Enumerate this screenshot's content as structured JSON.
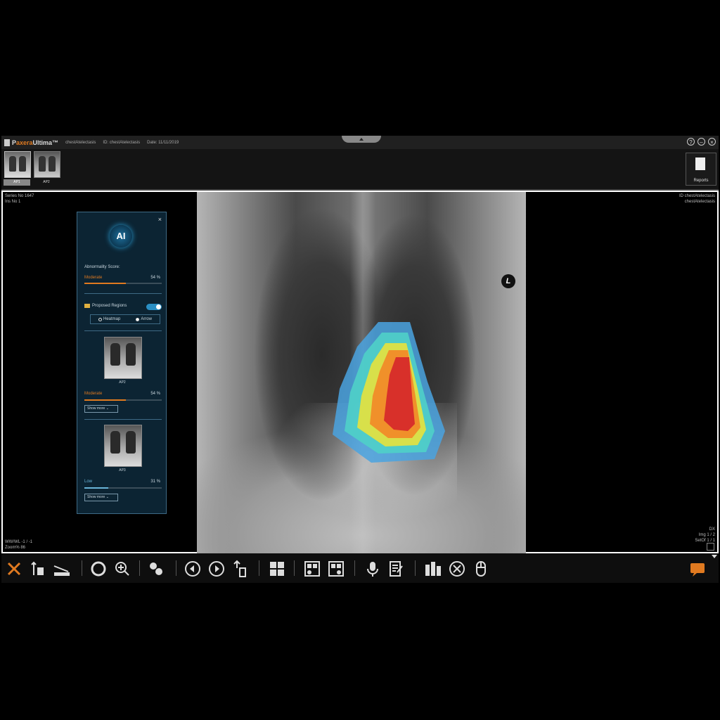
{
  "titlebar": {
    "app_name_prefix": "P",
    "app_name_accent": "axera",
    "app_name_suffix": "Ultima™",
    "patient": "chestAtelectasis",
    "id": "ID: chestAtelectasis",
    "date": "Date: 11/11/2019",
    "buttons": [
      "?",
      "–",
      "×"
    ]
  },
  "thumbnails": [
    {
      "label": "AP1",
      "selected": true
    },
    {
      "label": "AP2",
      "selected": false
    }
  ],
  "reports_label": "Reports",
  "viewport": {
    "series": "Series No 1647",
    "image_no": "Ins No 1",
    "id_right": "ID chestAtelectasis",
    "name_right": "chestAtelectasis",
    "wwwl": "WW/WL -1 / -1",
    "zoom": "Zoom% 86",
    "modality": "DX",
    "img": "Img 1 / 2",
    "set": "SetOf 1 / 1",
    "side_marker": "L"
  },
  "ai_panel": {
    "logo": "AI",
    "abnormality_label": "Abnormality Score:",
    "abnormality_level": "Moderate",
    "abnormality_pct": "54 %",
    "abnormality_value": 0.54,
    "proposed_regions": "Proposed Regions",
    "proposed_regions_on": true,
    "radio_heatmap": "Heatmap",
    "radio_arrow": "Arrow",
    "radio_selected": "Arrow",
    "items": [
      {
        "label": "AP2",
        "level": "Moderate",
        "pct": "54 %",
        "value": 0.54,
        "show_more": "Show more"
      },
      {
        "label": "AP3",
        "level": "Low",
        "pct": "31 %",
        "value": 0.31,
        "show_more": "Show more"
      }
    ]
  },
  "colors": {
    "accent_orange": "#e07a20",
    "panel_bg": "#0c2433",
    "panel_border": "#3e6a85",
    "toggle_blue": "#2a8fc4"
  },
  "toolbar": {
    "tools": [
      "tools-icon",
      "annotation-icon",
      "measure-icon",
      "window-level-icon",
      "zoom-icon",
      "compare-icon",
      "prev-icon",
      "next-icon",
      "scroll-icon",
      "layout-icon",
      "series-layout-icon",
      "image-layout-icon",
      "dictation-icon",
      "report-edit-icon",
      "series-view-icon",
      "settings-icon",
      "mouse-icon",
      "chat-icon"
    ]
  }
}
